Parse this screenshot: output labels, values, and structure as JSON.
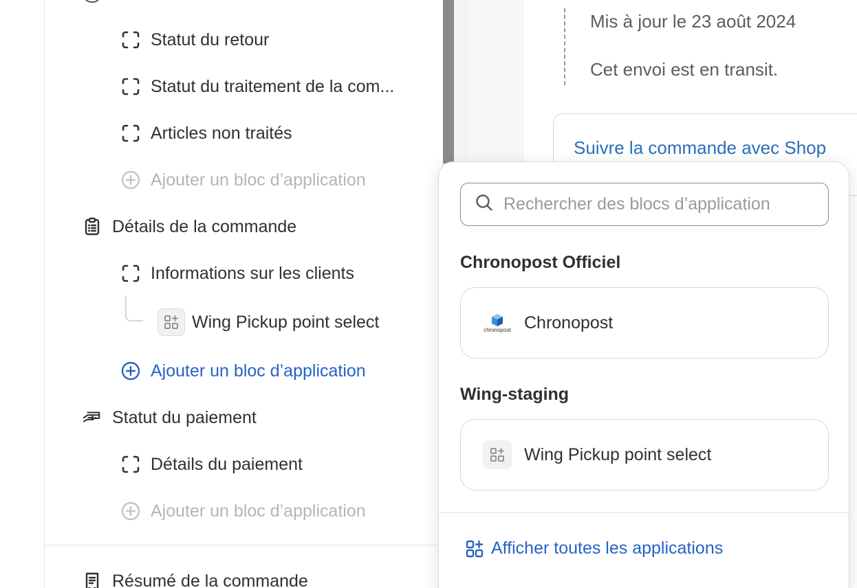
{
  "sidebar": {
    "items": [
      {
        "label": "Statut du retour"
      },
      {
        "label": "Statut du traitement de la com..."
      },
      {
        "label": "Articles non traités"
      },
      {
        "label": "Ajouter un bloc d’application"
      },
      {
        "label": "Détails de la commande"
      },
      {
        "label": "Informations sur les clients"
      },
      {
        "label": "Wing Pickup point select"
      },
      {
        "label": "Ajouter un bloc d’application"
      },
      {
        "label": "Statut du paiement"
      },
      {
        "label": "Détails du paiement"
      },
      {
        "label": "Ajouter un bloc d’application"
      },
      {
        "label": "Résumé de la commande"
      }
    ]
  },
  "preview": {
    "updated": "Mis à jour le 23 août 2024",
    "transit": "Cet envoi est en transit.",
    "track_link": "Suivre la commande avec Shop"
  },
  "popover": {
    "search_placeholder": "Rechercher des blocs d’application",
    "groups": [
      {
        "title": "Chronopost Officiel",
        "app": "Chronopost",
        "logo_text": "chronopost"
      },
      {
        "title": "Wing-staging",
        "app": "Wing Pickup point select"
      }
    ],
    "show_all": "Afficher toutes les applications"
  },
  "colors": {
    "accent": "#2563c6",
    "link": "#2a6fb8",
    "muted": "#b5b5b5",
    "text": "#303030"
  },
  "icons": [
    "block-icon",
    "add-circle-icon",
    "clipboard-icon",
    "app-grid-icon",
    "hand-payment-icon",
    "receipt-icon",
    "search-icon",
    "chronopost-logo"
  ]
}
